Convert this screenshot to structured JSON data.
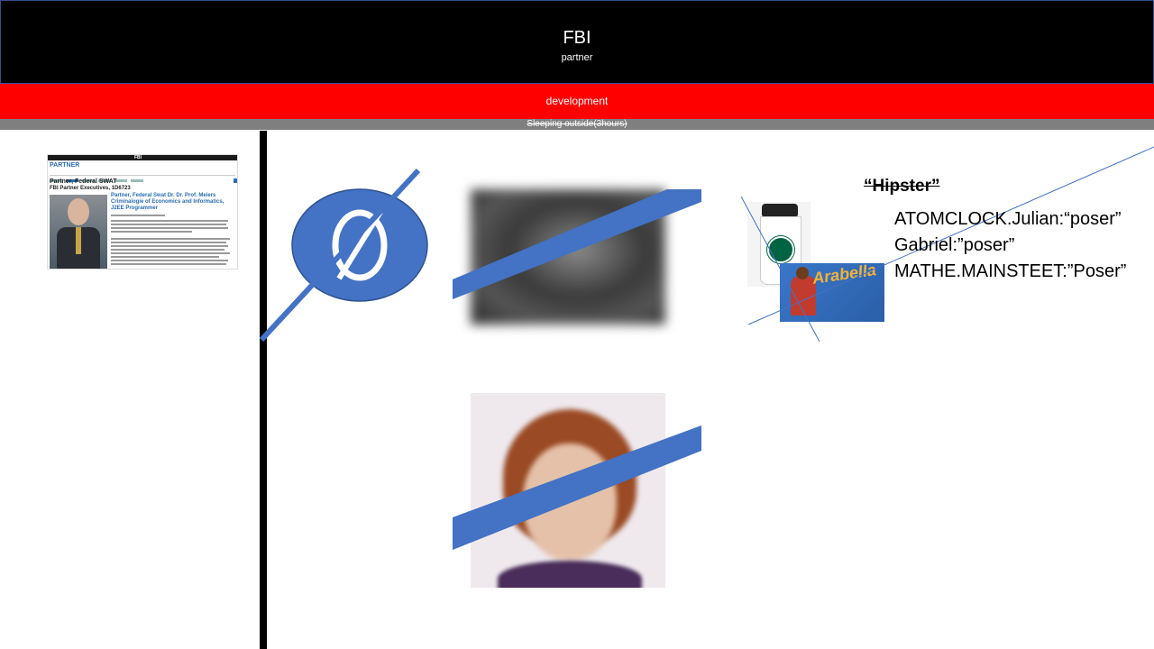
{
  "header": {
    "title": "FBI",
    "subtitle": "partner"
  },
  "redbar": {
    "label": "development"
  },
  "graybar": {
    "label": "Sleeping outside(3hours)"
  },
  "thumbnail": {
    "site_name": "FBI",
    "section_heading": "PARTNER",
    "page_heading": "Partner, Federal SWAT",
    "subheading": "FBI Partner Executives, 1D6723",
    "profile_title": "Partner, Federal Swat Dr. Dr. Prof. Meiers Criminalogie of Economics and Informatics, J2EE Programmer"
  },
  "hipster": {
    "title": "“Hipster”",
    "lines": [
      "ATOMCLOCK.Julian:“poser”",
      "Gabriel:”poser”",
      "MATHE.MAINSTEET:”Poser”"
    ]
  },
  "colors": {
    "header_bg": "#000000",
    "redbar_bg": "#ff0000",
    "graybar_bg": "#7f7f7f",
    "slash_blue": "#4472c4"
  }
}
